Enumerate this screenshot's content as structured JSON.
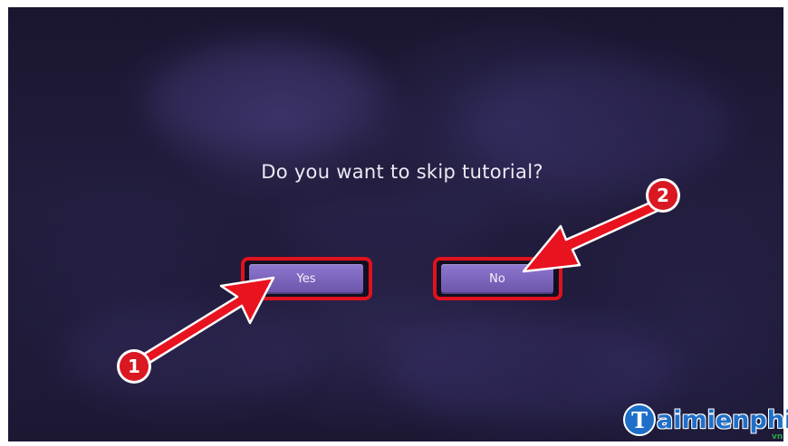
{
  "dialog": {
    "prompt": "Do you want to skip tutorial?",
    "yes_label": "Yes",
    "no_label": "No"
  },
  "annotations": {
    "marker_1": "1",
    "marker_2": "2",
    "highlight_color": "#e0121d"
  },
  "watermark": {
    "mark_letter": "T",
    "text": "aimienphi",
    "suffix": "vn"
  },
  "colors": {
    "button": "#7a63ba",
    "background": "#1f1a38",
    "brand": "#1f6fc9"
  }
}
